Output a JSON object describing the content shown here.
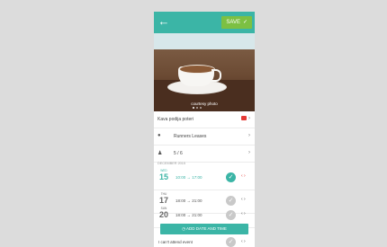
{
  "header": {
    "save_label": "SAVE",
    "colors": {
      "accent": "#3bb5a6",
      "save": "#7cc043"
    }
  },
  "hero": {
    "caption": "courtesy photo"
  },
  "rows": {
    "question": "Kava podija poteri",
    "location": "Runners Leases",
    "attendees": "5 / 6"
  },
  "dates_section": {
    "label": "DECEMBER 2015",
    "items": [
      {
        "dow": "WED",
        "day": "15",
        "times": "10:00  →  17:00"
      },
      {
        "dow": "THU",
        "day": "17",
        "times": "18:00  →  21:00"
      },
      {
        "dow": "SUN",
        "day": "20",
        "times": "18:00  →  21:00"
      }
    ]
  },
  "add_button_label": "ADD DATE AND TIME",
  "bottom": {
    "label": "I can't attend event"
  }
}
